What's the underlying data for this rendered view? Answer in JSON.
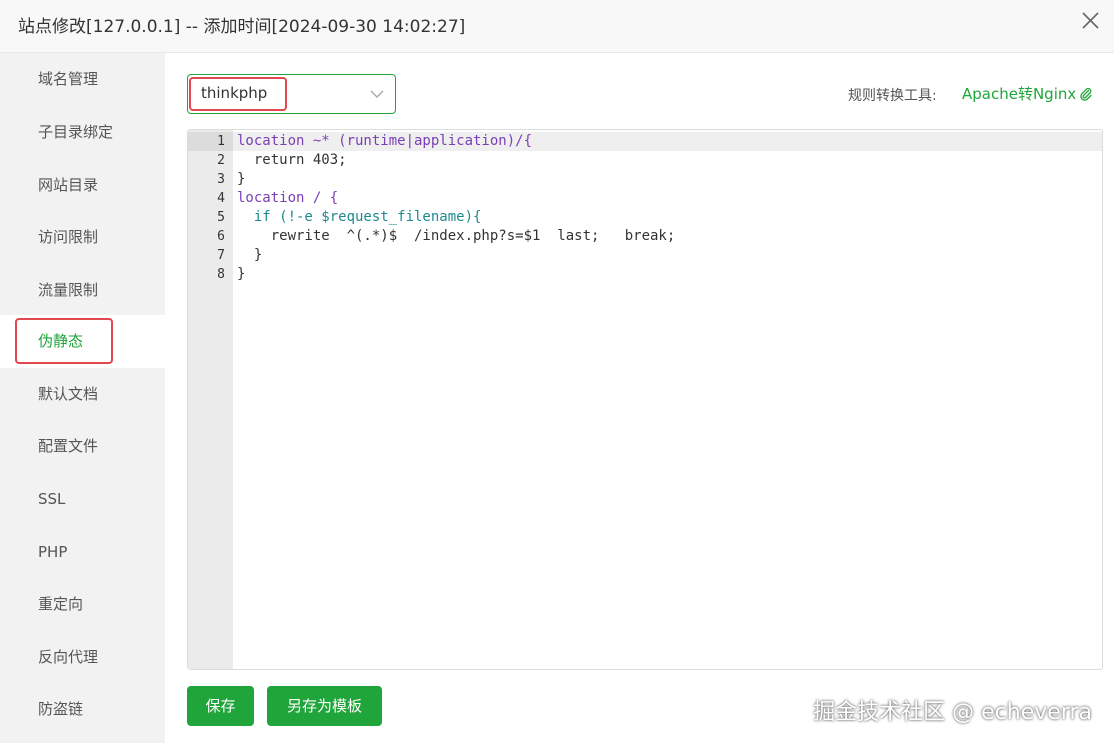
{
  "window": {
    "title": "站点修改[127.0.0.1] -- 添加时间[2024-09-30 14:02:27]"
  },
  "sidebar": {
    "items": [
      {
        "label": "域名管理"
      },
      {
        "label": "子目录绑定"
      },
      {
        "label": "网站目录"
      },
      {
        "label": "访问限制"
      },
      {
        "label": "流量限制"
      },
      {
        "label": "伪静态",
        "active": true
      },
      {
        "label": "默认文档"
      },
      {
        "label": "配置文件"
      },
      {
        "label": "SSL"
      },
      {
        "label": "PHP"
      },
      {
        "label": "重定向"
      },
      {
        "label": "反向代理"
      },
      {
        "label": "防盗链"
      }
    ]
  },
  "template_select": {
    "value": "thinkphp"
  },
  "tool": {
    "label": "规则转换工具:",
    "link": "Apache转Nginx"
  },
  "editor": {
    "lines": [
      {
        "num": "1",
        "text": "location ~* (runtime|application)/{"
      },
      {
        "num": "2",
        "text": "  return 403;"
      },
      {
        "num": "3",
        "text": "}"
      },
      {
        "num": "4",
        "text": "location / {"
      },
      {
        "num": "5",
        "text": "  if (!-e $request_filename){"
      },
      {
        "num": "6",
        "text": "    rewrite  ^(.*)$  /index.php?s=$1  last;   break;"
      },
      {
        "num": "7",
        "text": "  }"
      },
      {
        "num": "8",
        "text": "}"
      }
    ]
  },
  "buttons": {
    "save": "保存",
    "save_template": "另存为模板"
  },
  "watermark": "掘金技术社区 @ echeverra",
  "colors": {
    "accent": "#20a53a",
    "highlight": "#e2494f"
  }
}
